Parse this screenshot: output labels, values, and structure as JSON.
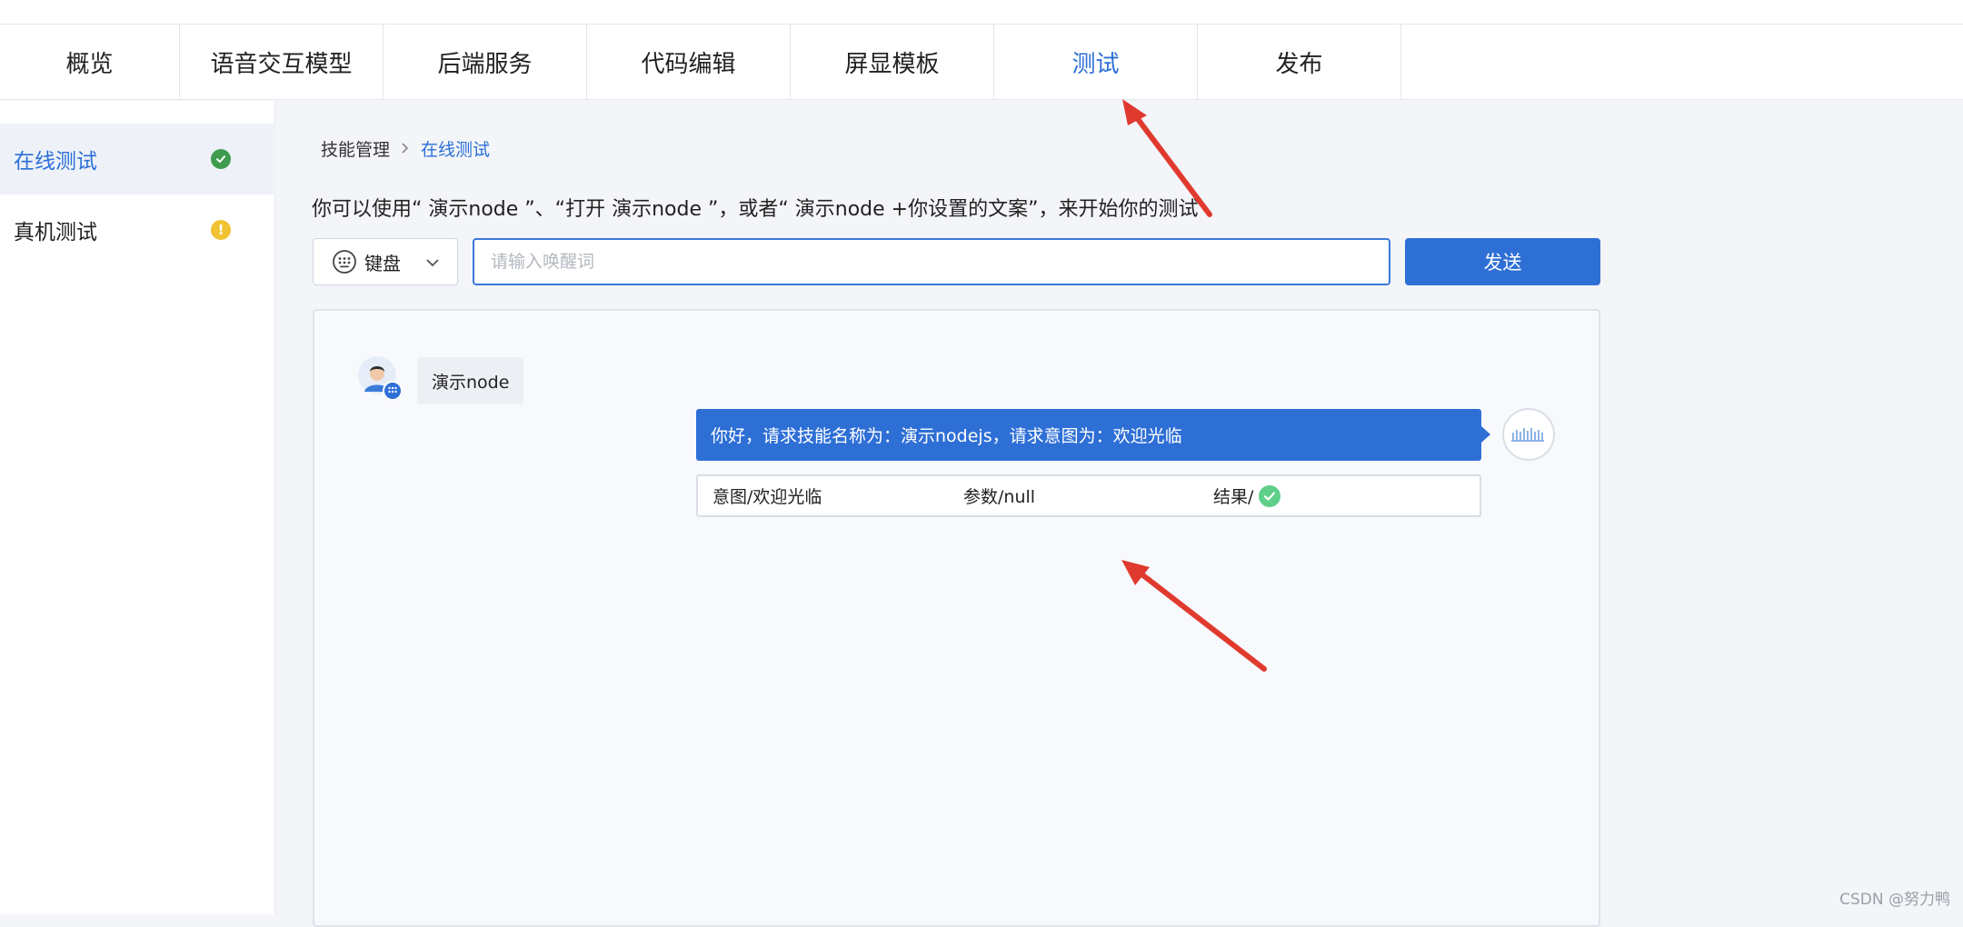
{
  "nav": {
    "tabs": [
      {
        "label": "概览"
      },
      {
        "label": "语音交互模型"
      },
      {
        "label": "后端服务"
      },
      {
        "label": "代码编辑"
      },
      {
        "label": "屏显模板"
      },
      {
        "label": "测试",
        "active": true
      },
      {
        "label": "发布"
      }
    ]
  },
  "sidebar": {
    "items": [
      {
        "label": "在线测试",
        "status": "success",
        "active": true
      },
      {
        "label": "真机测试",
        "status": "warning"
      }
    ]
  },
  "breadcrumb": {
    "root": "技能管理",
    "current": "在线测试"
  },
  "hint": "你可以使用“ 演示node ”、“打开 演示node ”，或者“ 演示node +你设置的文案”，来开始你的测试",
  "input_mode": {
    "label": "键盘",
    "icon": "keyboard-icon"
  },
  "wake_input": {
    "value": "",
    "placeholder": "请输入唤醒词"
  },
  "send_label": "发送",
  "conversation": {
    "user_message": "演示node",
    "bot_message": "你好，请求技能名称为：演示nodejs，请求意图为：欢迎光临",
    "result": {
      "intent": "意图/欢迎光临",
      "params": "参数/null",
      "result_label": "结果/",
      "result_status": "success"
    }
  },
  "watermark": "CSDN @努力鸭",
  "colors": {
    "accent": "#2e6fd6",
    "success": "#3f9c4f",
    "warning": "#f1c232",
    "annotation_arrow": "#e03a2f"
  }
}
